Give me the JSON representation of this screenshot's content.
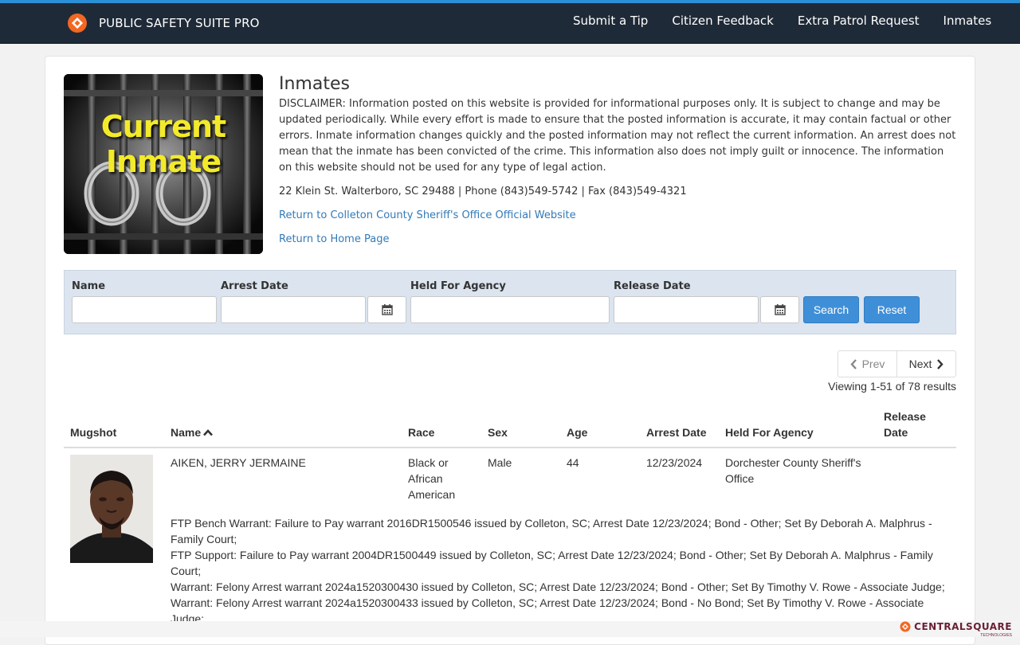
{
  "brand": {
    "name": "PUBLIC SAFETY SUITE PRO"
  },
  "nav": {
    "items": [
      "Submit a Tip",
      "Citizen Feedback",
      "Extra Patrol Request",
      "Inmates"
    ]
  },
  "colors": {
    "accent": "#337ab7",
    "navbar": "#1f2a38",
    "button": "#3f8fd8",
    "panel": "#dbe4ef",
    "brand_orange": "#f26722"
  },
  "hero": {
    "image_text": "Current Inmate"
  },
  "page": {
    "title": "Inmates",
    "disclaimer": "DISCLAIMER: Information posted on this website is provided for informational purposes only. It is subject to change and may be updated periodically. While every effort is made to ensure that the posted information is accurate, it may contain factual or other errors. Inmate information changes quickly and the posted information may not reflect the current information. An arrest does not mean that the inmate has been convicted of the crime. This information also does not imply guilt or innocence.  The information on this website should not be used for any type of legal action.",
    "address": "22 Klein St. Walterboro, SC 29488 | Phone (843)549-5742 | Fax (843)549-4321",
    "link_sheriff": "Return to Colleton County Sheriff's Office Official Website",
    "link_home": "Return to Home Page"
  },
  "search": {
    "name_label": "Name",
    "arrest_date_label": "Arrest Date",
    "agency_label": "Held For Agency",
    "release_date_label": "Release Date",
    "name_value": "",
    "arrest_date_value": "",
    "agency_value": "",
    "release_date_value": "",
    "search_button": "Search",
    "reset_button": "Reset"
  },
  "pagination": {
    "prev": "Prev",
    "next": "Next",
    "viewing": "Viewing 1-51 of 78 results"
  },
  "table": {
    "headers": [
      "Mugshot",
      "Name",
      "Race",
      "Sex",
      "Age",
      "Arrest Date",
      "Held For Agency",
      "Release Date"
    ],
    "rows": [
      {
        "name": "AIKEN, JERRY JERMAINE",
        "race": "Black or African American",
        "sex": "Male",
        "age": "44",
        "arrest_date": "12/23/2024",
        "agency": "Dorchester County Sheriff's Office",
        "release_date": "",
        "charges": [
          "FTP Bench Warrant: Failure to Pay warrant 2016DR1500546 issued by Colleton, SC; Arrest Date 12/23/2024; Bond - Other; Set By Deborah A. Malphrus - Family Court;",
          "FTP Support: Failure to Pay warrant 2004DR1500449 issued by Colleton, SC; Arrest Date 12/23/2024; Bond - Other; Set By Deborah A. Malphrus - Family Court;",
          "Warrant: Felony Arrest warrant 2024a1520300430 issued by Colleton, SC; Arrest Date 12/23/2024; Bond - Other; Set By Timothy V. Rowe - Associate Judge;",
          "Warrant: Felony Arrest warrant 2024a1520300433 issued by Colleton, SC; Arrest Date 12/23/2024; Bond - No Bond; Set By Timothy V. Rowe - Associate Judge;"
        ]
      }
    ]
  },
  "footer": {
    "vendor": "CENTRALSQUARE",
    "vendor_sub": "TECHNOLOGIES"
  }
}
